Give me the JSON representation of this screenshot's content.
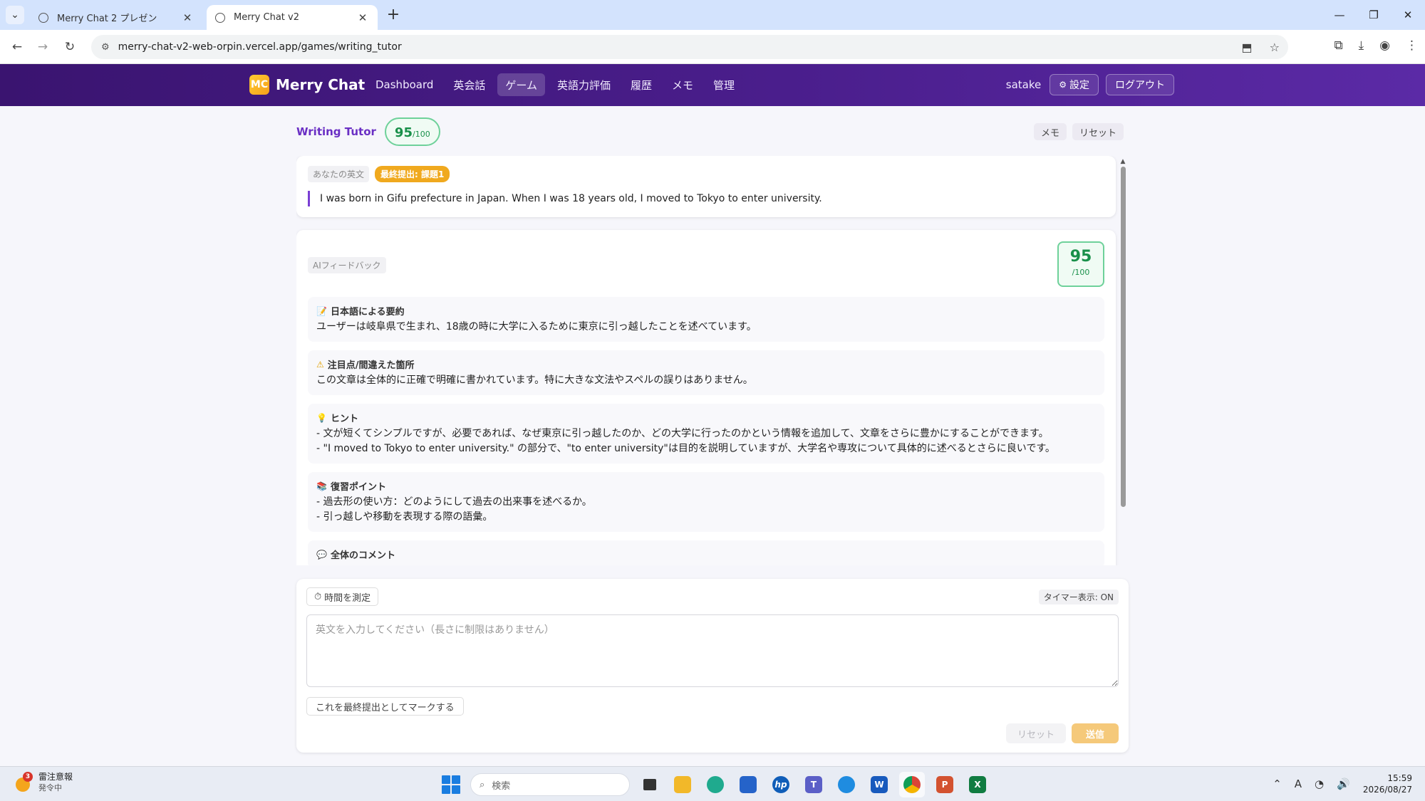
{
  "browser": {
    "tabs": [
      {
        "title": "Merry Chat 2 プレゼン",
        "active": false
      },
      {
        "title": "Merry Chat v2",
        "active": true
      }
    ],
    "url": "merry-chat-v2-web-orpin.vercel.app/games/writing_tutor"
  },
  "app": {
    "logo_text": "MC",
    "brand": "Merry Chat",
    "nav": [
      "Dashboard",
      "英会話",
      "ゲーム",
      "英語力評価",
      "履歴",
      "メモ",
      "管理"
    ],
    "active_nav": "ゲーム",
    "username": "satake",
    "settings_label": "設定",
    "logout_label": "ログアウト"
  },
  "game": {
    "title": "Writing Tutor",
    "score": "95",
    "score_max": "/100",
    "memo_label": "メモ",
    "reset_label": "リセット"
  },
  "essay": {
    "label": "あなたの英文",
    "final_tag": "最終提出: 課題1",
    "text": "I was born in Gifu prefecture in Japan. When I was 18 years old, I moved to Tokyo to enter university."
  },
  "feedback": {
    "label": "AIフィードバック",
    "score": "95",
    "score_max": "/100",
    "sections": [
      {
        "icon": "memo-icon",
        "glyph": "📝",
        "title": "日本語による要約",
        "lines": [
          "ユーザーは岐阜県で生まれ、18歳の時に大学に入るために東京に引っ越したことを述べています。"
        ]
      },
      {
        "icon": "warning-icon",
        "glyph": "⚠",
        "title": "注目点/間違えた箇所",
        "lines": [
          "この文章は全体的に正確で明確に書かれています。特に大きな文法やスペルの誤りはありません。"
        ]
      },
      {
        "icon": "lightbulb-icon",
        "glyph": "💡",
        "title": "ヒント",
        "lines": [
          "- 文が短くてシンプルですが、必要であれば、なぜ東京に引っ越したのか、どの大学に行ったのかという情報を追加して、文章をさらに豊かにすることができます。",
          "- \"I moved to Tokyo to enter university.\" の部分で、\"to enter university\"は目的を説明していますが、大学名や専攻について具体的に述べるとさらに良いです。"
        ]
      },
      {
        "icon": "books-icon",
        "glyph": "📚",
        "title": "復習ポイント",
        "lines": [
          "- 過去形の使い方：どのようにして過去の出来事を述べるか。",
          "- 引っ越しや移動を表現する際の語彙。"
        ]
      },
      {
        "icon": "speech-icon",
        "glyph": "💬",
        "title": "全体のコメント",
        "lines": []
      }
    ]
  },
  "composer": {
    "timer_label": "時間を測定",
    "timer_status": "タイマー表示: ON",
    "placeholder": "英文を入力してください（長さに制限はありません）",
    "mark_final_label": "これを最終提出としてマークする",
    "reset_label": "リセット",
    "send_label": "送信"
  },
  "taskbar": {
    "weather_badge": "3",
    "weather_line1": "雷注意報",
    "weather_line2": "発令中",
    "search_placeholder": "検索",
    "time": "15:59",
    "date": "2026/08/27"
  }
}
